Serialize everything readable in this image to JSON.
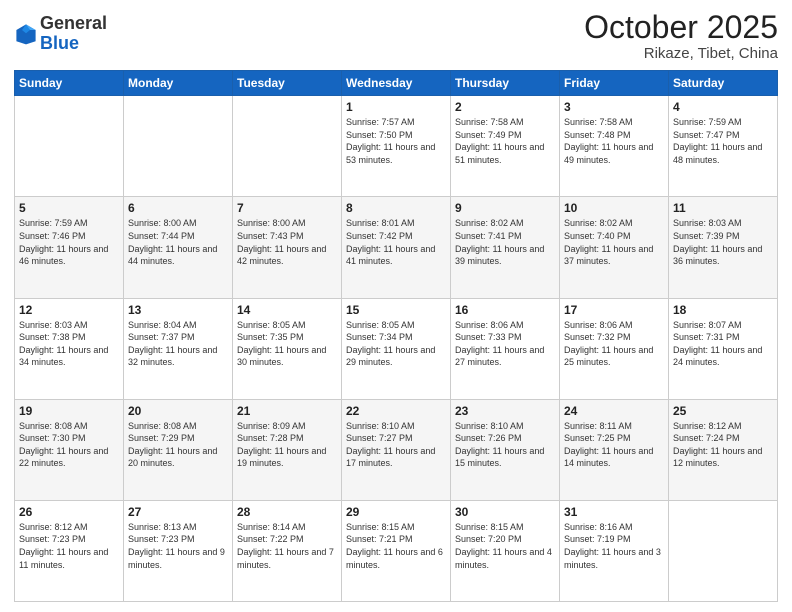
{
  "header": {
    "logo_general": "General",
    "logo_blue": "Blue",
    "title": "October 2025",
    "location": "Rikaze, Tibet, China"
  },
  "days_of_week": [
    "Sunday",
    "Monday",
    "Tuesday",
    "Wednesday",
    "Thursday",
    "Friday",
    "Saturday"
  ],
  "weeks": [
    [
      {
        "day": "",
        "info": ""
      },
      {
        "day": "",
        "info": ""
      },
      {
        "day": "",
        "info": ""
      },
      {
        "day": "1",
        "info": "Sunrise: 7:57 AM\nSunset: 7:50 PM\nDaylight: 11 hours and 53 minutes."
      },
      {
        "day": "2",
        "info": "Sunrise: 7:58 AM\nSunset: 7:49 PM\nDaylight: 11 hours and 51 minutes."
      },
      {
        "day": "3",
        "info": "Sunrise: 7:58 AM\nSunset: 7:48 PM\nDaylight: 11 hours and 49 minutes."
      },
      {
        "day": "4",
        "info": "Sunrise: 7:59 AM\nSunset: 7:47 PM\nDaylight: 11 hours and 48 minutes."
      }
    ],
    [
      {
        "day": "5",
        "info": "Sunrise: 7:59 AM\nSunset: 7:46 PM\nDaylight: 11 hours and 46 minutes."
      },
      {
        "day": "6",
        "info": "Sunrise: 8:00 AM\nSunset: 7:44 PM\nDaylight: 11 hours and 44 minutes."
      },
      {
        "day": "7",
        "info": "Sunrise: 8:00 AM\nSunset: 7:43 PM\nDaylight: 11 hours and 42 minutes."
      },
      {
        "day": "8",
        "info": "Sunrise: 8:01 AM\nSunset: 7:42 PM\nDaylight: 11 hours and 41 minutes."
      },
      {
        "day": "9",
        "info": "Sunrise: 8:02 AM\nSunset: 7:41 PM\nDaylight: 11 hours and 39 minutes."
      },
      {
        "day": "10",
        "info": "Sunrise: 8:02 AM\nSunset: 7:40 PM\nDaylight: 11 hours and 37 minutes."
      },
      {
        "day": "11",
        "info": "Sunrise: 8:03 AM\nSunset: 7:39 PM\nDaylight: 11 hours and 36 minutes."
      }
    ],
    [
      {
        "day": "12",
        "info": "Sunrise: 8:03 AM\nSunset: 7:38 PM\nDaylight: 11 hours and 34 minutes."
      },
      {
        "day": "13",
        "info": "Sunrise: 8:04 AM\nSunset: 7:37 PM\nDaylight: 11 hours and 32 minutes."
      },
      {
        "day": "14",
        "info": "Sunrise: 8:05 AM\nSunset: 7:35 PM\nDaylight: 11 hours and 30 minutes."
      },
      {
        "day": "15",
        "info": "Sunrise: 8:05 AM\nSunset: 7:34 PM\nDaylight: 11 hours and 29 minutes."
      },
      {
        "day": "16",
        "info": "Sunrise: 8:06 AM\nSunset: 7:33 PM\nDaylight: 11 hours and 27 minutes."
      },
      {
        "day": "17",
        "info": "Sunrise: 8:06 AM\nSunset: 7:32 PM\nDaylight: 11 hours and 25 minutes."
      },
      {
        "day": "18",
        "info": "Sunrise: 8:07 AM\nSunset: 7:31 PM\nDaylight: 11 hours and 24 minutes."
      }
    ],
    [
      {
        "day": "19",
        "info": "Sunrise: 8:08 AM\nSunset: 7:30 PM\nDaylight: 11 hours and 22 minutes."
      },
      {
        "day": "20",
        "info": "Sunrise: 8:08 AM\nSunset: 7:29 PM\nDaylight: 11 hours and 20 minutes."
      },
      {
        "day": "21",
        "info": "Sunrise: 8:09 AM\nSunset: 7:28 PM\nDaylight: 11 hours and 19 minutes."
      },
      {
        "day": "22",
        "info": "Sunrise: 8:10 AM\nSunset: 7:27 PM\nDaylight: 11 hours and 17 minutes."
      },
      {
        "day": "23",
        "info": "Sunrise: 8:10 AM\nSunset: 7:26 PM\nDaylight: 11 hours and 15 minutes."
      },
      {
        "day": "24",
        "info": "Sunrise: 8:11 AM\nSunset: 7:25 PM\nDaylight: 11 hours and 14 minutes."
      },
      {
        "day": "25",
        "info": "Sunrise: 8:12 AM\nSunset: 7:24 PM\nDaylight: 11 hours and 12 minutes."
      }
    ],
    [
      {
        "day": "26",
        "info": "Sunrise: 8:12 AM\nSunset: 7:23 PM\nDaylight: 11 hours and 11 minutes."
      },
      {
        "day": "27",
        "info": "Sunrise: 8:13 AM\nSunset: 7:23 PM\nDaylight: 11 hours and 9 minutes."
      },
      {
        "day": "28",
        "info": "Sunrise: 8:14 AM\nSunset: 7:22 PM\nDaylight: 11 hours and 7 minutes."
      },
      {
        "day": "29",
        "info": "Sunrise: 8:15 AM\nSunset: 7:21 PM\nDaylight: 11 hours and 6 minutes."
      },
      {
        "day": "30",
        "info": "Sunrise: 8:15 AM\nSunset: 7:20 PM\nDaylight: 11 hours and 4 minutes."
      },
      {
        "day": "31",
        "info": "Sunrise: 8:16 AM\nSunset: 7:19 PM\nDaylight: 11 hours and 3 minutes."
      },
      {
        "day": "",
        "info": ""
      }
    ]
  ]
}
